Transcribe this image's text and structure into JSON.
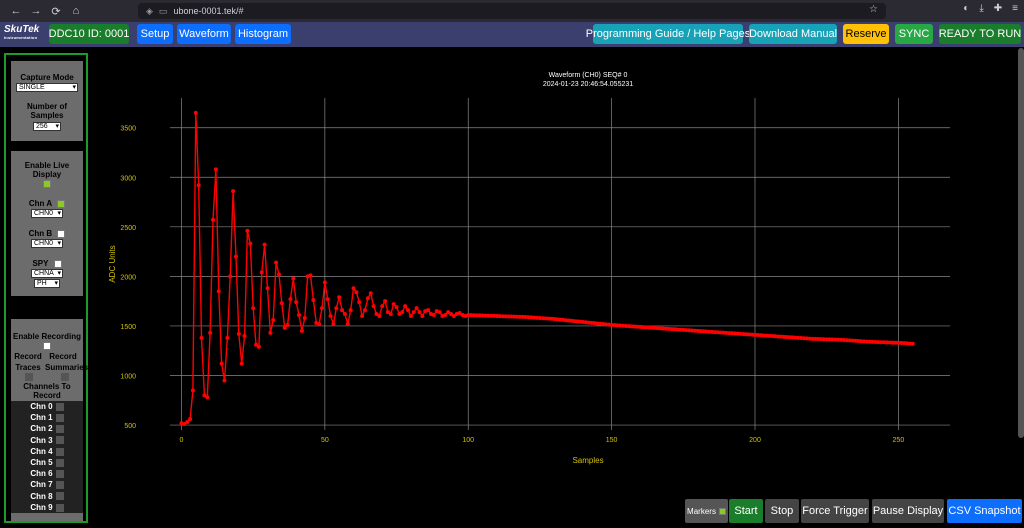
{
  "browser": {
    "back": "←",
    "forward": "→",
    "reload": "⟳",
    "home": "⌂",
    "url": "ubone-0001.tek/#",
    "star": "☆"
  },
  "logo": {
    "name": "SkuTek",
    "sub": "Instrumentation"
  },
  "header": {
    "device_id": "DDC10 ID: 0001",
    "setup": "Setup",
    "waveform": "Waveform",
    "histogram": "Histogram",
    "programming_guide": "Programming Guide / Help Pages",
    "download_manual": "Download Manual",
    "reserve": "Reserve",
    "sync": "SYNC",
    "status": "READY TO RUN"
  },
  "sidebar": {
    "capture_mode_label": "Capture Mode",
    "capture_mode_value": "SINGLE",
    "num_samples_label": "Number of Samples",
    "num_samples_value": "256",
    "live_display_label": "Enable Live Display",
    "chn_a_label": "Chn A",
    "chn_a_select": "CHN0",
    "chn_b_label": "Chn B",
    "chn_b_select": "CHN0",
    "spy_label": "SPY",
    "spy_select": "CHNA",
    "spy_select2": "PH",
    "recording_label": "Enable Recording",
    "record_traces_label": "Record Traces",
    "record_summaries_label": "Record Summaries",
    "channels_to_record_label": "Channels To Record",
    "channels": [
      "Chn 0",
      "Chn 1",
      "Chn 2",
      "Chn 3",
      "Chn 4",
      "Chn 5",
      "Chn 6",
      "Chn 7",
      "Chn 8",
      "Chn 9"
    ]
  },
  "bottom": {
    "markers": "Markers",
    "start": "Start",
    "stop": "Stop",
    "force_trigger": "Force Trigger",
    "pause_display": "Pause Display",
    "csv_snapshot": "CSV Snapshot"
  },
  "colors": {
    "series": "#ff0000",
    "axis_text": "#d4c200",
    "grid": "#888888"
  },
  "chart_data": {
    "type": "line",
    "title": "Waveform (CH0) SEQ# 0",
    "subtitle": "2024-01-23 20:46:54.055231",
    "xlabel": "Samples",
    "ylabel": "ADC Units",
    "xlim": [
      -4,
      268
    ],
    "ylim": [
      450,
      3800
    ],
    "xticks": [
      0,
      50,
      100,
      150,
      200,
      250
    ],
    "yticks": [
      500,
      1000,
      1500,
      2000,
      2500,
      3000,
      3500
    ],
    "grid": true,
    "series": [
      {
        "name": "CH0",
        "points": [
          [
            0,
            520
          ],
          [
            1,
            510
          ],
          [
            2,
            530
          ],
          [
            3,
            560
          ],
          [
            4,
            850
          ],
          [
            5,
            3650
          ],
          [
            6,
            2920
          ],
          [
            7,
            1380
          ],
          [
            8,
            800
          ],
          [
            9,
            780
          ],
          [
            10,
            1430
          ],
          [
            11,
            2570
          ],
          [
            12,
            3080
          ],
          [
            13,
            1850
          ],
          [
            14,
            1120
          ],
          [
            15,
            950
          ],
          [
            16,
            1380
          ],
          [
            17,
            2000
          ],
          [
            18,
            2860
          ],
          [
            19,
            2200
          ],
          [
            20,
            1420
          ],
          [
            21,
            1120
          ],
          [
            22,
            1400
          ],
          [
            23,
            2460
          ],
          [
            24,
            2330
          ],
          [
            25,
            1680
          ],
          [
            26,
            1310
          ],
          [
            27,
            1290
          ],
          [
            28,
            2040
          ],
          [
            29,
            2320
          ],
          [
            30,
            1880
          ],
          [
            31,
            1430
          ],
          [
            32,
            1560
          ],
          [
            33,
            2140
          ],
          [
            34,
            2020
          ],
          [
            35,
            1730
          ],
          [
            36,
            1480
          ],
          [
            37,
            1510
          ],
          [
            38,
            1770
          ],
          [
            39,
            1980
          ],
          [
            40,
            1740
          ],
          [
            41,
            1610
          ],
          [
            42,
            1450
          ],
          [
            43,
            1580
          ],
          [
            44,
            2000
          ],
          [
            45,
            2010
          ],
          [
            46,
            1760
          ],
          [
            47,
            1530
          ],
          [
            48,
            1520
          ],
          [
            49,
            1680
          ],
          [
            50,
            1940
          ],
          [
            51,
            1770
          ],
          [
            52,
            1600
          ],
          [
            53,
            1520
          ],
          [
            54,
            1680
          ],
          [
            55,
            1790
          ],
          [
            56,
            1660
          ],
          [
            57,
            1620
          ],
          [
            58,
            1520
          ],
          [
            59,
            1660
          ],
          [
            60,
            1880
          ],
          [
            61,
            1840
          ],
          [
            62,
            1740
          ],
          [
            63,
            1600
          ],
          [
            64,
            1660
          ],
          [
            65,
            1780
          ],
          [
            66,
            1830
          ],
          [
            67,
            1700
          ],
          [
            68,
            1620
          ],
          [
            69,
            1600
          ],
          [
            70,
            1700
          ],
          [
            71,
            1750
          ],
          [
            72,
            1640
          ],
          [
            73,
            1620
          ],
          [
            74,
            1720
          ],
          [
            75,
            1690
          ],
          [
            76,
            1620
          ],
          [
            77,
            1640
          ],
          [
            78,
            1700
          ],
          [
            79,
            1660
          ],
          [
            80,
            1600
          ],
          [
            81,
            1640
          ],
          [
            82,
            1680
          ],
          [
            83,
            1640
          ],
          [
            84,
            1600
          ],
          [
            85,
            1650
          ],
          [
            86,
            1660
          ],
          [
            87,
            1620
          ],
          [
            88,
            1610
          ],
          [
            89,
            1650
          ],
          [
            90,
            1640
          ],
          [
            91,
            1600
          ],
          [
            92,
            1610
          ],
          [
            93,
            1640
          ],
          [
            94,
            1620
          ],
          [
            95,
            1600
          ],
          [
            96,
            1620
          ],
          [
            97,
            1630
          ],
          [
            98,
            1610
          ],
          [
            99,
            1600
          ],
          [
            100,
            1610
          ],
          [
            110,
            1600
          ],
          [
            120,
            1590
          ],
          [
            130,
            1570
          ],
          [
            140,
            1540
          ],
          [
            150,
            1510
          ],
          [
            160,
            1490
          ],
          [
            170,
            1470
          ],
          [
            180,
            1450
          ],
          [
            190,
            1430
          ],
          [
            200,
            1410
          ],
          [
            210,
            1390
          ],
          [
            220,
            1370
          ],
          [
            230,
            1360
          ],
          [
            240,
            1340
          ],
          [
            250,
            1330
          ],
          [
            255,
            1320
          ]
        ]
      }
    ]
  }
}
